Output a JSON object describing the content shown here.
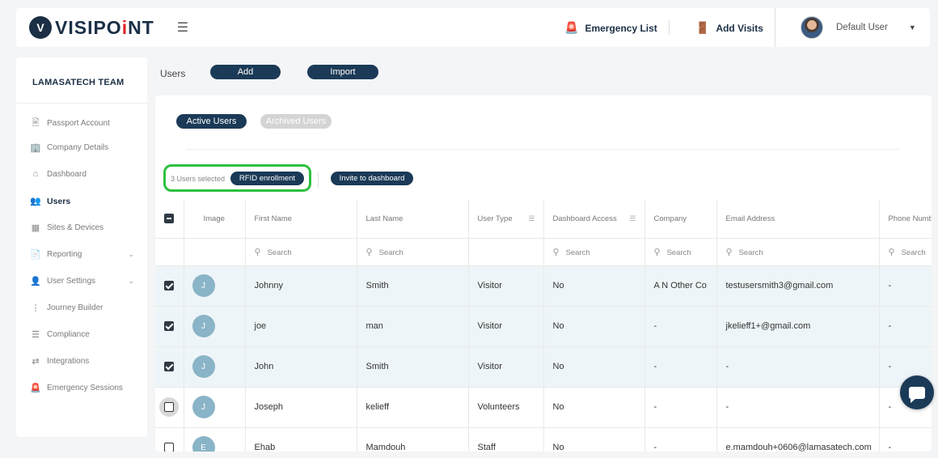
{
  "header": {
    "logo_mark": "V",
    "logo_text_start": "VISIPO",
    "logo_text_dot": "i",
    "logo_text_end": "NT",
    "menu_icon": "hamburger-icon",
    "emergency_label": "Emergency List",
    "emergency_icon": "siren-icon",
    "add_visits_label": "Add Visits",
    "add_visits_icon": "door-icon",
    "user_name": "Default User"
  },
  "sidebar": {
    "team": "LAMASATECH TEAM",
    "items": [
      {
        "label": "Passport Account",
        "icon": "passport-icon"
      },
      {
        "label": "Company Details",
        "icon": "building-icon"
      },
      {
        "label": "Dashboard",
        "icon": "home-icon"
      },
      {
        "label": "Users",
        "icon": "users-icon",
        "active": true
      },
      {
        "label": "Sites & Devices",
        "icon": "devices-icon"
      },
      {
        "label": "Reporting",
        "icon": "report-icon",
        "expandable": true
      },
      {
        "label": "User Settings",
        "icon": "user-settings-icon",
        "expandable": true
      },
      {
        "label": "Journey Builder",
        "icon": "journey-icon"
      },
      {
        "label": "Compliance",
        "icon": "compliance-icon"
      },
      {
        "label": "Integrations",
        "icon": "integrations-icon"
      },
      {
        "label": "Emergency Sessions",
        "icon": "siren-icon"
      }
    ]
  },
  "page": {
    "title": "Users",
    "add_label": "Add",
    "import_label": "Import",
    "tab_active": "Active Users",
    "tab_archived": "Archived Users",
    "selected_count": "3 Users selected",
    "rfid_label": "RFID enrollment",
    "invite_label": "Invite to dashboard"
  },
  "table": {
    "columns": [
      "Image",
      "First Name",
      "Last Name",
      "User Type",
      "Dashboard Access",
      "Company",
      "Email Address",
      "Phone Number"
    ],
    "search_placeholder": "Search",
    "rows": [
      {
        "initial": "J",
        "first": "Johnny",
        "last": "Smith",
        "type": "Visitor",
        "access": "No",
        "company": "A N Other Co",
        "email": "testusersmith3@gmail.com",
        "phone": "-",
        "checked": true
      },
      {
        "initial": "J",
        "first": "joe",
        "last": "man",
        "type": "Visitor",
        "access": "No",
        "company": "-",
        "email": "jkelieff1+@gmail.com",
        "phone": "-",
        "checked": true
      },
      {
        "initial": "J",
        "first": "John",
        "last": "Smith",
        "type": "Visitor",
        "access": "No",
        "company": "-",
        "email": "-",
        "phone": "-",
        "checked": true
      },
      {
        "initial": "J",
        "first": "Joseph",
        "last": "kelieff",
        "type": "Volunteers",
        "access": "No",
        "company": "-",
        "email": "-",
        "phone": "-",
        "checked": false
      },
      {
        "initial": "E",
        "first": "Ehab",
        "last": "Mamdouh",
        "type": "Staff",
        "access": "No",
        "company": "-",
        "email": "e.mamdouh+0606@lamasatech.com",
        "phone": "-",
        "checked": false
      }
    ]
  },
  "colors": {
    "brand_navy": "#1b3a57",
    "brand_red": "#e0242a",
    "highlight_green": "#2cc13f",
    "avatar_blue": "#8ab4c7"
  }
}
